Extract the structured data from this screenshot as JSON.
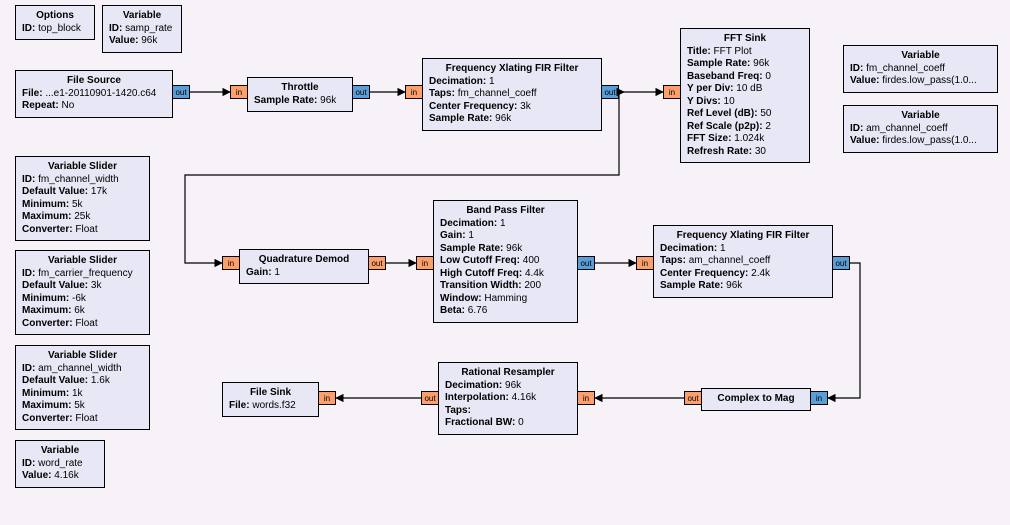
{
  "labels": {
    "in": "in",
    "out": "out"
  },
  "blocks": {
    "options": {
      "title": "Options",
      "props": [
        [
          "ID:",
          "top_block"
        ]
      ]
    },
    "var_samp": {
      "title": "Variable",
      "props": [
        [
          "ID:",
          "samp_rate"
        ],
        [
          "Value:",
          "96k"
        ]
      ]
    },
    "file_source": {
      "title": "File Source",
      "props": [
        [
          "File:",
          "...e1-20110901-1420.c64"
        ],
        [
          "Repeat:",
          "No"
        ]
      ]
    },
    "throttle": {
      "title": "Throttle",
      "props": [
        [
          "Sample Rate:",
          "96k"
        ]
      ]
    },
    "freq_fir1": {
      "title": "Frequency Xlating FIR Filter",
      "props": [
        [
          "Decimation:",
          "1"
        ],
        [
          "Taps:",
          "fm_channel_coeff"
        ],
        [
          "Center Frequency:",
          "3k"
        ],
        [
          "Sample Rate:",
          "96k"
        ]
      ]
    },
    "fft_sink": {
      "title": "FFT Sink",
      "props": [
        [
          "Title:",
          "FFT Plot"
        ],
        [
          "Sample Rate:",
          "96k"
        ],
        [
          "Baseband Freq:",
          "0"
        ],
        [
          "Y per Div:",
          "10 dB"
        ],
        [
          "Y Divs:",
          "10"
        ],
        [
          "Ref Level (dB):",
          "50"
        ],
        [
          "Ref Scale (p2p):",
          "2"
        ],
        [
          "FFT Size:",
          "1.024k"
        ],
        [
          "Refresh Rate:",
          "30"
        ]
      ]
    },
    "var_fm_coeff": {
      "title": "Variable",
      "props": [
        [
          "ID:",
          "fm_channel_coeff"
        ],
        [
          "Value:",
          "firdes.low_pass(1.0..."
        ]
      ]
    },
    "var_am_coeff": {
      "title": "Variable",
      "props": [
        [
          "ID:",
          "am_channel_coeff"
        ],
        [
          "Value:",
          "firdes.low_pass(1.0..."
        ]
      ]
    },
    "slider_fm_w": {
      "title": "Variable Slider",
      "props": [
        [
          "ID:",
          "fm_channel_width"
        ],
        [
          "Default Value:",
          "17k"
        ],
        [
          "Minimum:",
          "5k"
        ],
        [
          "Maximum:",
          "25k"
        ],
        [
          "Converter:",
          "Float"
        ]
      ]
    },
    "slider_fm_cf": {
      "title": "Variable Slider",
      "props": [
        [
          "ID:",
          "fm_carrier_frequency"
        ],
        [
          "Default Value:",
          "3k"
        ],
        [
          "Minimum:",
          "-6k"
        ],
        [
          "Maximum:",
          "6k"
        ],
        [
          "Converter:",
          "Float"
        ]
      ]
    },
    "slider_am_w": {
      "title": "Variable Slider",
      "props": [
        [
          "ID:",
          "am_channel_width"
        ],
        [
          "Default Value:",
          "1.6k"
        ],
        [
          "Minimum:",
          "1k"
        ],
        [
          "Maximum:",
          "5k"
        ],
        [
          "Converter:",
          "Float"
        ]
      ]
    },
    "var_word": {
      "title": "Variable",
      "props": [
        [
          "ID:",
          "word_rate"
        ],
        [
          "Value:",
          "4.16k"
        ]
      ]
    },
    "quad": {
      "title": "Quadrature Demod",
      "props": [
        [
          "Gain:",
          "1"
        ]
      ]
    },
    "bpf": {
      "title": "Band Pass Filter",
      "props": [
        [
          "Decimation:",
          "1"
        ],
        [
          "Gain:",
          "1"
        ],
        [
          "Sample Rate:",
          "96k"
        ],
        [
          "Low Cutoff Freq:",
          "400"
        ],
        [
          "High Cutoff Freq:",
          "4.4k"
        ],
        [
          "Transition Width:",
          "200"
        ],
        [
          "Window:",
          "Hamming"
        ],
        [
          "Beta:",
          "6.76"
        ]
      ]
    },
    "freq_fir2": {
      "title": "Frequency Xlating FIR Filter",
      "props": [
        [
          "Decimation:",
          "1"
        ],
        [
          "Taps:",
          "am_channel_coeff"
        ],
        [
          "Center Frequency:",
          "2.4k"
        ],
        [
          "Sample Rate:",
          "96k"
        ]
      ]
    },
    "c2m": {
      "title": "Complex to Mag",
      "props": []
    },
    "resamp": {
      "title": "Rational Resampler",
      "props": [
        [
          "Decimation:",
          "96k"
        ],
        [
          "Interpolation:",
          "4.16k"
        ],
        [
          "Taps:",
          ""
        ],
        [
          "Fractional BW:",
          "0"
        ]
      ]
    },
    "file_sink": {
      "title": "File Sink",
      "props": [
        [
          "File:",
          "words.f32"
        ]
      ]
    }
  }
}
